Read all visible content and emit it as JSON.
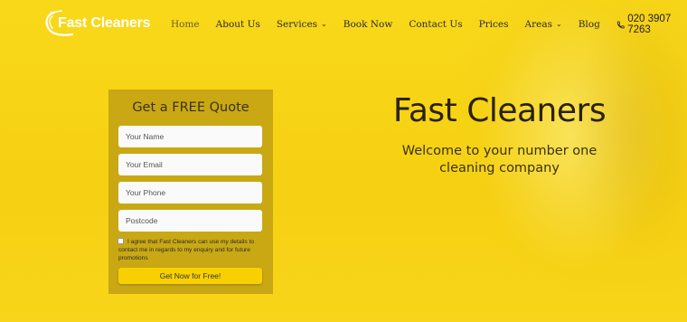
{
  "brand": {
    "logo_text": "Fast Cleaners"
  },
  "nav": {
    "items": [
      {
        "label": "Home",
        "active": true
      },
      {
        "label": "About Us"
      },
      {
        "label": "Services",
        "dropdown": true
      },
      {
        "label": "Book Now"
      },
      {
        "label": "Contact Us"
      },
      {
        "label": "Prices"
      },
      {
        "label": "Areas",
        "dropdown": true
      },
      {
        "label": "Blog"
      }
    ],
    "phone": "020 3907 7263"
  },
  "quote_form": {
    "title": "Get a FREE Quote",
    "name_placeholder": "Your Name",
    "email_placeholder": "Your Email",
    "phone_placeholder": "Your Phone",
    "postcode_placeholder": "Postcode",
    "consent_text": "I agree that Fast Cleaners can use my details to contact me in regards to my enquiry and for future promotions",
    "submit_label": "Get Now for Free!"
  },
  "hero": {
    "title": "Fast Cleaners",
    "subtitle": "Welcome to your number one cleaning company"
  },
  "colors": {
    "background": "#f7d417",
    "form_panel": "#c9a814",
    "button": "#f8d000"
  },
  "icons": [
    "swoosh-logo-icon",
    "chevron-down-icon",
    "phone-icon"
  ]
}
